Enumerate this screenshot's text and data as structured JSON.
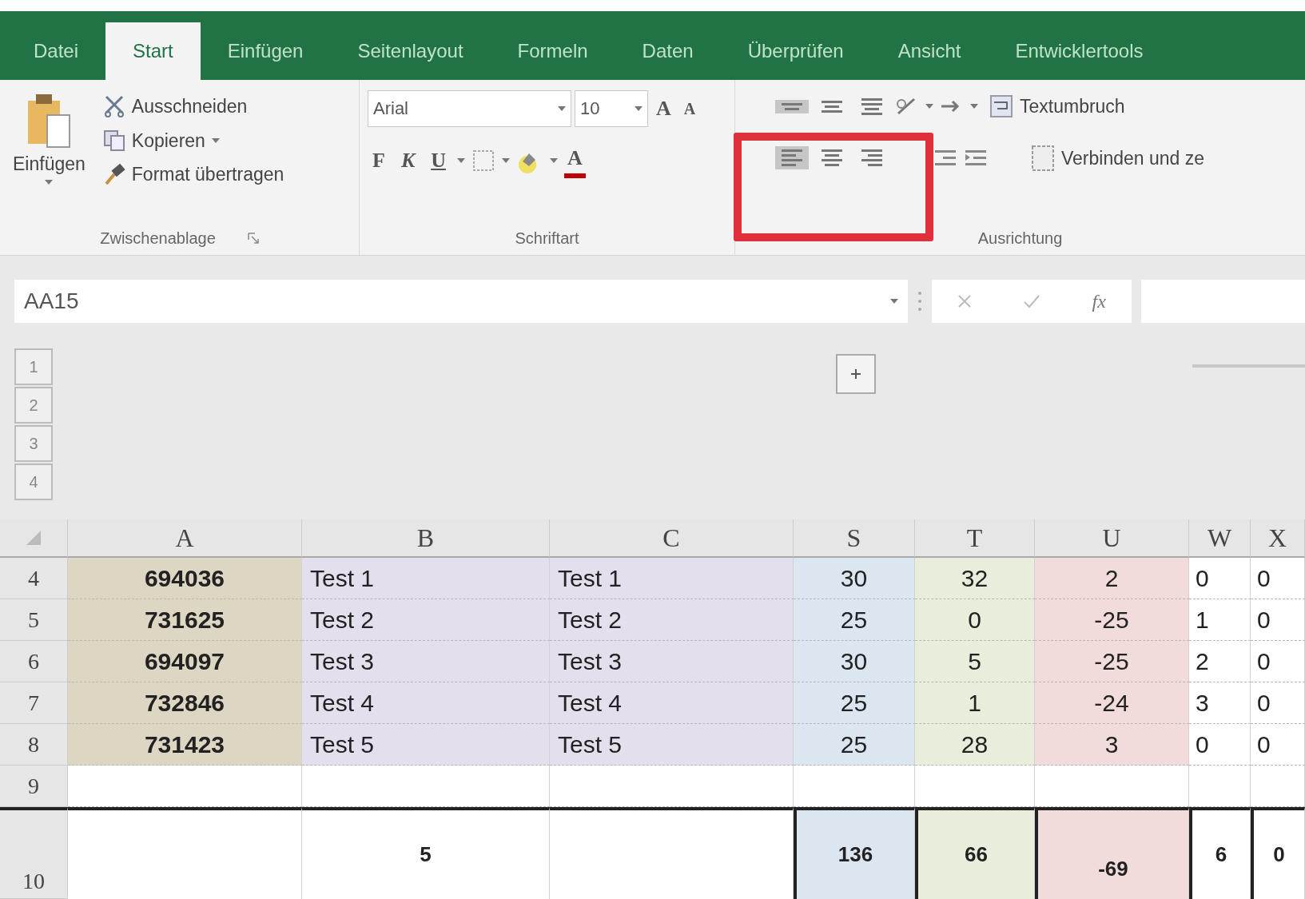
{
  "tabs": [
    {
      "label": "Datei",
      "selected": false
    },
    {
      "label": "Start",
      "selected": true
    },
    {
      "label": "Einfügen",
      "selected": false
    },
    {
      "label": "Seitenlayout",
      "selected": false
    },
    {
      "label": "Formeln",
      "selected": false
    },
    {
      "label": "Daten",
      "selected": false
    },
    {
      "label": "Überprüfen",
      "selected": false
    },
    {
      "label": "Ansicht",
      "selected": false
    },
    {
      "label": "Entwicklertools",
      "selected": false
    }
  ],
  "clipboard": {
    "paste": "Einfügen",
    "items": [
      {
        "kind": "cut",
        "label": "Ausschneiden"
      },
      {
        "kind": "copy",
        "label": "Kopieren"
      },
      {
        "kind": "brush",
        "label": "Format übertragen"
      }
    ],
    "group_label": "Zwischenablage"
  },
  "font": {
    "name": "Arial",
    "size": "10",
    "grow": "A",
    "shrink": "A",
    "bold": "F",
    "italic": "K",
    "underline": "U",
    "font_color": "A",
    "group_label": "Schriftart"
  },
  "alignment": {
    "vertical": [
      {
        "kind": "top",
        "selected": true
      },
      {
        "kind": "middle",
        "selected": false
      },
      {
        "kind": "bottom",
        "selected": false
      }
    ],
    "horizontal": [
      {
        "kind": "left",
        "selected": true
      },
      {
        "kind": "center",
        "selected": false
      },
      {
        "kind": "right",
        "selected": false
      }
    ],
    "wrap": "Textumbruch",
    "merge": "Verbinden und ze",
    "group_label": "Ausrichtung"
  },
  "formula_bar": {
    "name_box": "AA15",
    "fx": "fx"
  },
  "outline_levels": [
    "1",
    "2",
    "3",
    "4"
  ],
  "columns": [
    {
      "label": "A",
      "kind": "id",
      "color": "#ddd6c2"
    },
    {
      "label": "B",
      "kind": "text",
      "color": "#e3dfec"
    },
    {
      "label": "C",
      "kind": "text",
      "color": "#e3dfec"
    },
    {
      "label": "S",
      "kind": "number",
      "color": "#dce6f1"
    },
    {
      "label": "T",
      "kind": "number",
      "color": "#e8eddc"
    },
    {
      "label": "U",
      "kind": "number",
      "color": "#f2dcdb"
    },
    {
      "label": "W",
      "kind": "small"
    },
    {
      "label": "X",
      "kind": "small"
    }
  ],
  "rows": [
    {
      "header": "4",
      "kind": "data",
      "cells": [
        "694036",
        "Test 1",
        "Test 1",
        "30",
        "32",
        "2",
        "0",
        "0"
      ]
    },
    {
      "header": "5",
      "kind": "data",
      "cells": [
        "731625",
        "Test 2",
        "Test 2",
        "25",
        "0",
        "-25",
        "1",
        "0"
      ]
    },
    {
      "header": "6",
      "kind": "data",
      "cells": [
        "694097",
        "Test 3",
        "Test 3",
        "30",
        "5",
        "-25",
        "2",
        "0"
      ]
    },
    {
      "header": "7",
      "kind": "data",
      "cells": [
        "732846",
        "Test 4",
        "Test 4",
        "25",
        "1",
        "-24",
        "3",
        "0"
      ]
    },
    {
      "header": "8",
      "kind": "data",
      "cells": [
        "731423",
        "Test 5",
        "Test 5",
        "25",
        "28",
        "3",
        "0",
        "0"
      ]
    },
    {
      "header": "9",
      "kind": "empty",
      "cells": []
    },
    {
      "header": "10",
      "kind": "total",
      "cells": [
        "",
        "5",
        "",
        "136",
        "66",
        "-69",
        "6",
        "0"
      ]
    }
  ]
}
